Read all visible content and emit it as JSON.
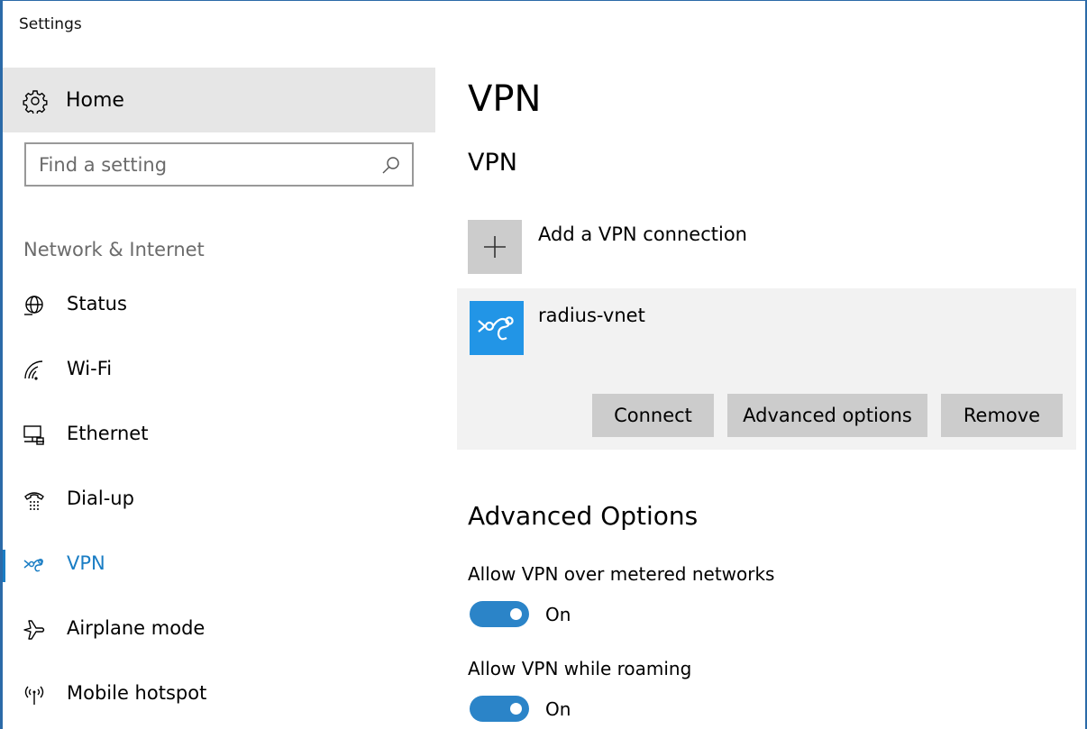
{
  "window": {
    "title": "Settings"
  },
  "sidebar": {
    "home_label": "Home",
    "search_placeholder": "Find a setting",
    "section_header": "Network & Internet",
    "items": [
      {
        "label": "Status",
        "icon": "globe-icon"
      },
      {
        "label": "Wi-Fi",
        "icon": "wifi-icon"
      },
      {
        "label": "Ethernet",
        "icon": "ethernet-icon"
      },
      {
        "label": "Dial-up",
        "icon": "dialup-icon"
      },
      {
        "label": "VPN",
        "icon": "vpn-icon",
        "active": true
      },
      {
        "label": "Airplane mode",
        "icon": "airplane-icon"
      },
      {
        "label": "Mobile hotspot",
        "icon": "hotspot-icon"
      }
    ]
  },
  "main": {
    "page_title": "VPN",
    "section_title": "VPN",
    "add_vpn_label": "Add a VPN connection",
    "connection": {
      "name": "radius-vnet",
      "connect_label": "Connect",
      "advanced_label": "Advanced options",
      "remove_label": "Remove"
    },
    "advanced": {
      "title": "Advanced Options",
      "metered": {
        "label": "Allow VPN over metered networks",
        "state": "On",
        "on": true
      },
      "roaming": {
        "label": "Allow VPN while roaming",
        "state": "On",
        "on": true
      }
    }
  },
  "colors": {
    "accent": "#1a7dc4",
    "toggle_on": "#2b84c8",
    "vpn_tile": "#2295e6",
    "selected_bg": "#e6e6e6"
  }
}
